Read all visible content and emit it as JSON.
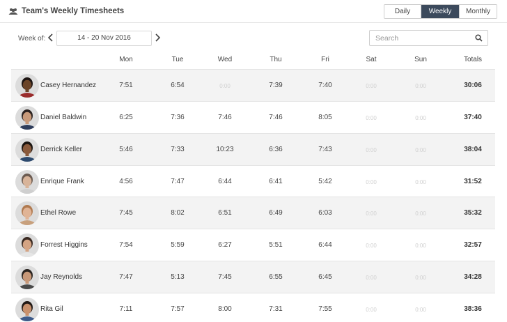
{
  "header": {
    "title": "Team's Weekly Timesheets",
    "title_icon": "users-icon",
    "views": [
      {
        "label": "Daily",
        "active": false
      },
      {
        "label": "Weekly",
        "active": true
      },
      {
        "label": "Monthly",
        "active": false
      }
    ]
  },
  "toolbar": {
    "week_label": "Week of:",
    "week_range": "14 - 20 Nov 2016",
    "prev_icon": "chevron-left-icon",
    "next_icon": "chevron-right-icon",
    "search_placeholder": "Search",
    "search_icon": "search-icon"
  },
  "table": {
    "columns": [
      "Mon",
      "Tue",
      "Wed",
      "Thu",
      "Fri",
      "Sat",
      "Sun",
      "Totals"
    ],
    "rows": [
      {
        "name": "Casey Hernandez",
        "days": [
          "7:51",
          "6:54",
          "0:00",
          "7:39",
          "7:40",
          "0:00",
          "0:00"
        ],
        "total": "30:06",
        "avatar": {
          "skin": "#6b4428",
          "hair": "#1c1412",
          "shirt": "#9a2c2c"
        }
      },
      {
        "name": "Daniel Baldwin",
        "days": [
          "6:25",
          "7:36",
          "7:46",
          "7:46",
          "8:05",
          "0:00",
          "0:00"
        ],
        "total": "37:40",
        "avatar": {
          "skin": "#c99a7a",
          "hair": "#2b2220",
          "shirt": "#2f3e5c"
        }
      },
      {
        "name": "Derrick Keller",
        "days": [
          "5:46",
          "7:33",
          "10:23",
          "6:36",
          "7:43",
          "0:00",
          "0:00"
        ],
        "total": "38:04",
        "avatar": {
          "skin": "#8a5a3c",
          "hair": "#1a1410",
          "shirt": "#2d4a6e"
        }
      },
      {
        "name": "Enrique Frank",
        "days": [
          "4:56",
          "7:47",
          "6:44",
          "6:41",
          "5:42",
          "0:00",
          "0:00"
        ],
        "total": "31:52",
        "avatar": {
          "skin": "#d8b49a",
          "hair": "#6a5a50",
          "shirt": "#cfcfcf"
        }
      },
      {
        "name": "Ethel Rowe",
        "days": [
          "7:45",
          "8:02",
          "6:51",
          "6:49",
          "6:03",
          "0:00",
          "0:00"
        ],
        "total": "35:32",
        "avatar": {
          "skin": "#e0b496",
          "hair": "#b07a50",
          "shirt": "#c8a07c"
        }
      },
      {
        "name": "Forrest Higgins",
        "days": [
          "7:54",
          "5:59",
          "6:27",
          "5:51",
          "6:44",
          "0:00",
          "0:00"
        ],
        "total": "32:57",
        "avatar": {
          "skin": "#d4a484",
          "hair": "#3a2a22",
          "shirt": "#e6e6e6"
        }
      },
      {
        "name": "Jay Reynolds",
        "days": [
          "7:47",
          "5:13",
          "7:45",
          "6:55",
          "6:45",
          "0:00",
          "0:00"
        ],
        "total": "34:28",
        "avatar": {
          "skin": "#c89878",
          "hair": "#2a2420",
          "shirt": "#4a4a4a"
        }
      },
      {
        "name": "Rita Gil",
        "days": [
          "7:11",
          "7:57",
          "8:00",
          "7:31",
          "7:55",
          "0:00",
          "0:00"
        ],
        "total": "38:36",
        "avatar": {
          "skin": "#c8906c",
          "hair": "#221a16",
          "shirt": "#3c5a8a"
        }
      }
    ]
  }
}
